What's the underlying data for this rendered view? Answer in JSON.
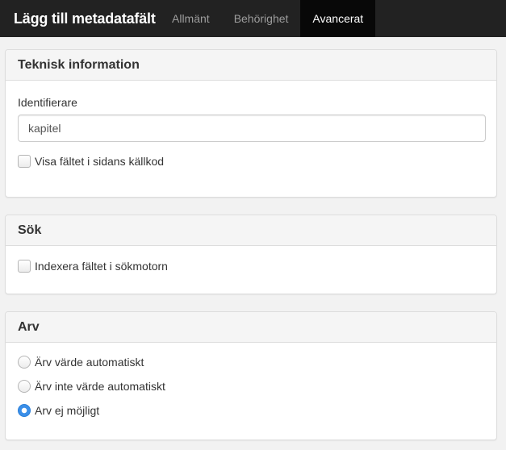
{
  "navbar": {
    "brand": "Lägg till metadatafält",
    "tabs": [
      {
        "label": "Allmänt",
        "active": false
      },
      {
        "label": "Behörighet",
        "active": false
      },
      {
        "label": "Avancerat",
        "active": true
      }
    ]
  },
  "technical": {
    "title": "Teknisk information",
    "identifier_label": "Identifierare",
    "identifier_value": "kapitel",
    "show_in_source_label": "Visa fältet i sidans källkod",
    "show_in_source_checked": false
  },
  "search": {
    "title": "Sök",
    "index_label": "Indexera fältet i sökmotorn",
    "index_checked": false
  },
  "inheritance": {
    "title": "Arv",
    "options": [
      {
        "label": "Ärv värde automatiskt",
        "checked": false
      },
      {
        "label": "Ärv inte värde automatiskt",
        "checked": false
      },
      {
        "label": "Arv ej möjligt",
        "checked": true
      }
    ]
  },
  "colors": {
    "navbar_bg": "#222222",
    "active_tab_bg": "#080808",
    "radio_accent": "#3b8fe8"
  }
}
